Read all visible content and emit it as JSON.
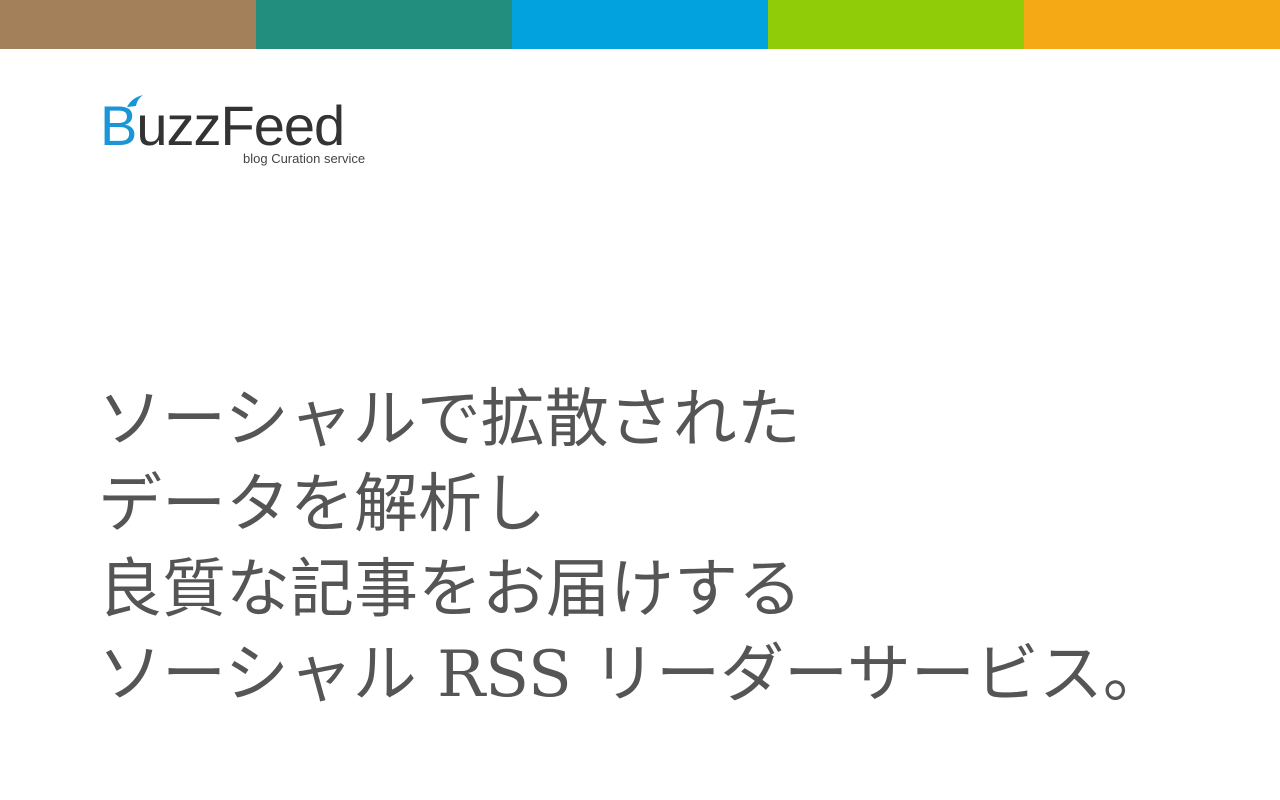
{
  "color_bar": {
    "colors": [
      "#a3805a",
      "#218e7e",
      "#01a2de",
      "#90cc08",
      "#f5aa15"
    ]
  },
  "logo": {
    "brand_initial": "B",
    "brand_rest": "uzzFeed",
    "tagline": "blog Curation service",
    "icon": "bird-icon"
  },
  "headline": {
    "lines": [
      "ソーシャルで拡散された",
      "データを解析し",
      "良質な記事をお届けする",
      "ソーシャル RSS リーダーサービス。"
    ]
  }
}
